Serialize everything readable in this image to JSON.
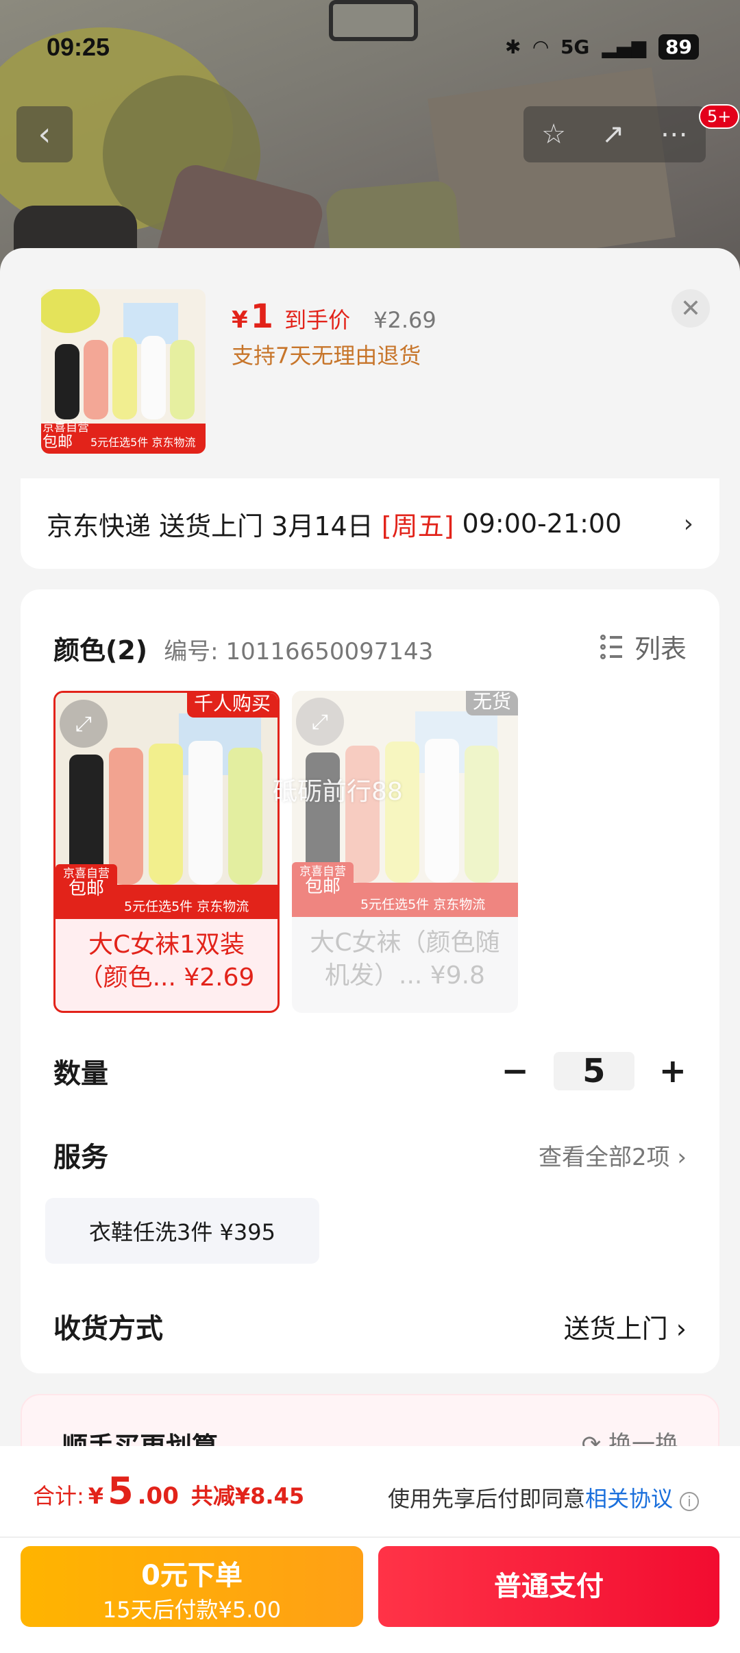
{
  "status": {
    "time": "09:25",
    "network": "5G",
    "battery": "89"
  },
  "nav": {
    "badge": "5+"
  },
  "product": {
    "currency": "¥",
    "price": "1",
    "price_label": "到手价",
    "original_price": "¥2.69",
    "return_policy": "支持7天无理由退货",
    "thumb_promo": "5元任选5件 京东物流",
    "thumb_badge_top": "京喜自营",
    "thumb_badge": "包邮"
  },
  "delivery": {
    "text": "京东快递 送货上门 3月14日",
    "weekday": "[周五]",
    "window": "09:00-21:00"
  },
  "color_section": {
    "title": "颜色(2)",
    "sku": "编号: 10116650097143",
    "list_label": "列表",
    "options": [
      {
        "tag": "千人购买",
        "name": "大C女袜1双装（颜色... ¥2.69",
        "selected": true
      },
      {
        "tag": "无货",
        "name": "大C女袜（颜色随机发）... ¥9.8",
        "selected": false
      }
    ],
    "watermark": "砥砺前行88"
  },
  "quantity": {
    "label": "数量",
    "minus": "−",
    "value": "5",
    "plus": "+"
  },
  "service": {
    "label": "服务",
    "more": "查看全部2项",
    "chip": "衣鞋任洗3件 ¥395"
  },
  "shipping": {
    "label": "收货方式",
    "value": "送货上门"
  },
  "upsell": {
    "title": "顺手买更划算",
    "refresh": "换一换"
  },
  "footer": {
    "total_label": "合计:",
    "total_currency": "¥",
    "total_int": "5",
    "total_dec": ".00",
    "saved": "共减¥8.45",
    "agree_text": "使用先享后付即同意",
    "agree_link": "相关协议",
    "btn_later_main": "0元下单",
    "btn_later_sub": "15天后付款¥5.00",
    "btn_pay": "普通支付"
  },
  "colors": {
    "accent": "#e2231a",
    "pay_button": "#f20c30",
    "later_button": "#ffa015",
    "link": "#1a6fdc"
  }
}
